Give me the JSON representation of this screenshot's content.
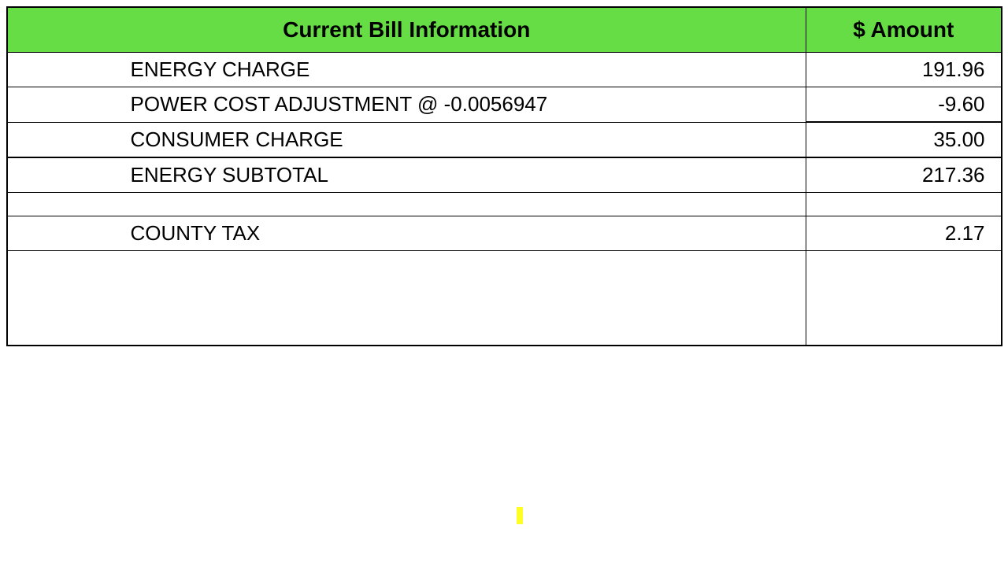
{
  "header": {
    "title": "Current Bill Information",
    "amount_col": "$ Amount"
  },
  "rows": [
    {
      "label": "ENERGY CHARGE",
      "amount": "191.96",
      "highlight": false,
      "highlight_label": false,
      "underline": false
    },
    {
      "label": "POWER COST ADJUSTMENT @ -0.0056947",
      "amount": "-9.60",
      "highlight": true,
      "highlight_label": true,
      "underline": false
    },
    {
      "label": "CONSUMER CHARGE",
      "amount": "35.00",
      "highlight": false,
      "highlight_label": false,
      "underline": true
    },
    {
      "label": "ENERGY SUBTOTAL",
      "amount": "217.36",
      "highlight": false,
      "highlight_label": false,
      "underline": false,
      "subtotal": true
    },
    {
      "label": "COUNTY TAX",
      "amount": "2.17",
      "highlight": false,
      "highlight_label": false,
      "underline": false,
      "spacer_before": true
    }
  ]
}
